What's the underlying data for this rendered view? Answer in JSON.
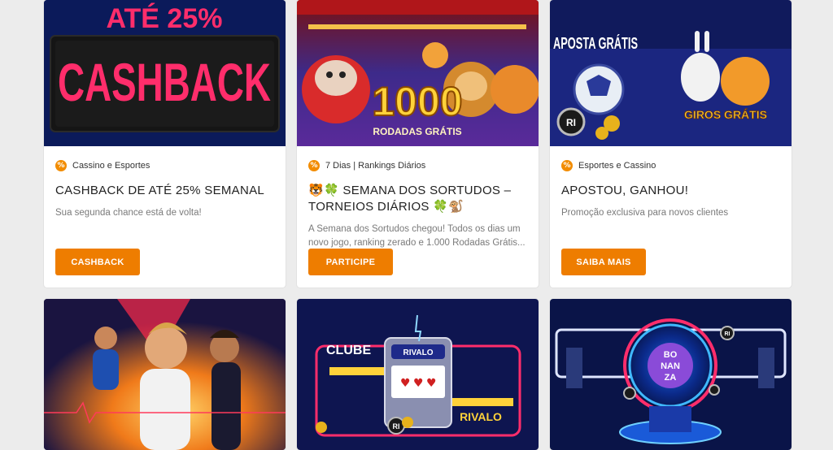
{
  "colors": {
    "accent": "#ee7d00",
    "tag_icon": "#f28c00",
    "page_bg": "#ececec",
    "card_bg": "#ffffff"
  },
  "promotions": [
    {
      "banner": {
        "headline_top": "ATÉ 25%",
        "headline_main": "CASHBACK"
      },
      "tag_icon": "percent-badge-icon",
      "tag": "Cassino e Esportes",
      "title": "CASHBACK DE ATÉ 25% SEMANAL",
      "description": "Sua segunda chance está de volta!",
      "button": "CASHBACK"
    },
    {
      "banner": {
        "headline_main": "1000",
        "headline_sub": "RODADAS GRÁTIS"
      },
      "tag_icon": "percent-badge-icon",
      "tag": "7 Dias | Rankings Diários",
      "title": "🐯🍀 SEMANA DOS SORTUDOS – TORNEIOS DIÁRIOS 🍀🐒",
      "description": "A Semana dos Sortudos chegou! Todos os dias um novo jogo, ranking zerado e 1.000 Rodadas Grátis...",
      "button": "PARTICIPE"
    },
    {
      "banner": {
        "headline_top": "APOSTA GRÁTIS",
        "headline_sub": "GIROS GRÁTIS",
        "coin_label": "RI"
      },
      "tag_icon": "percent-badge-icon",
      "tag": "Esportes e Cassino",
      "title": "APOSTOU, GANHOU!",
      "description": "Promoção exclusiva para novos clientes",
      "button": "SAIBA MAIS"
    }
  ],
  "bottom_banners": [
    {},
    {
      "sign_left": "CLUBE",
      "sign_right": "RIVALO",
      "slot_label": "RIVALO",
      "coin_label": "RI"
    },
    {
      "wheel_text": [
        "BO",
        "NAN",
        "ZA"
      ],
      "coin_label": "RI"
    }
  ]
}
